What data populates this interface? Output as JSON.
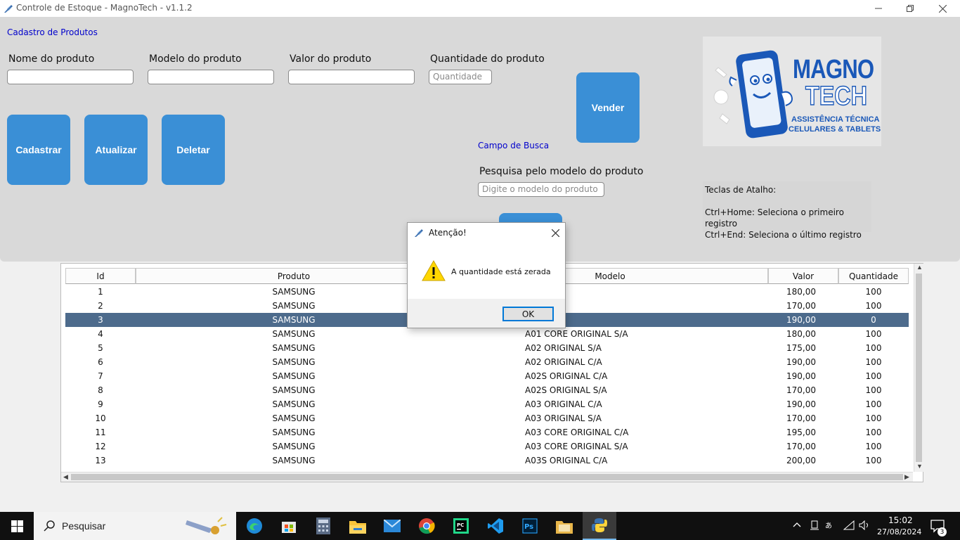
{
  "window": {
    "title": "Controle de Estoque - MagnoTech - v1.1.2",
    "minimize_icon": "minimize-icon",
    "restore_icon": "restore-icon",
    "close_icon": "close-icon"
  },
  "form": {
    "section_label": "Cadastro de Produtos",
    "nome_label": "Nome do produto",
    "nome_value": "",
    "modelo_label": "Modelo do produto",
    "modelo_value": "",
    "valor_label": "Valor do produto",
    "valor_value": "",
    "quantidade_label": "Quantidade do produto",
    "quantidade_placeholder": "Quantidade"
  },
  "buttons": {
    "cadastrar": "Cadastrar",
    "atualizar": "Atualizar",
    "deletar": "Deletar",
    "vender": "Vender",
    "accent_color": "#3a8fd6"
  },
  "search": {
    "section_label": "Campo de Busca",
    "label": "Pesquisa pelo modelo do produto",
    "placeholder": "Digite o modelo do produto"
  },
  "logo": {
    "line1": "MAGNO",
    "line2": "TECH",
    "line3": "ASSISTÊNCIA TÉCNICA",
    "line4": "CELULARES & TABLETS"
  },
  "shortcuts": {
    "title": "Teclas de Atalho:",
    "line1": "Ctrl+Home: Seleciona o primeiro registro",
    "line2": "Ctrl+End: Seleciona o último registro"
  },
  "table": {
    "columns": [
      "Id",
      "Produto",
      "Modelo",
      "Valor",
      "Quantidade"
    ],
    "selected_row": 2,
    "selected_color": "#4d6b8c",
    "rows": [
      [
        "1",
        "SAMSUNG",
        "",
        "180,00",
        "100"
      ],
      [
        "2",
        "SAMSUNG",
        "",
        "170,00",
        "100"
      ],
      [
        "3",
        "SAMSUNG",
        "",
        "190,00",
        "0"
      ],
      [
        "4",
        "SAMSUNG",
        "A01 CORE ORIGINAL S/A",
        "180,00",
        "100"
      ],
      [
        "5",
        "SAMSUNG",
        "A02 ORIGINAL S/A",
        "175,00",
        "100"
      ],
      [
        "6",
        "SAMSUNG",
        "A02 ORIGINAL C/A",
        "190,00",
        "100"
      ],
      [
        "7",
        "SAMSUNG",
        "A02S ORIGINAL C/A",
        "190,00",
        "100"
      ],
      [
        "8",
        "SAMSUNG",
        "A02S ORIGINAL S/A",
        "170,00",
        "100"
      ],
      [
        "9",
        "SAMSUNG",
        "A03 ORIGINAL C/A",
        "190,00",
        "100"
      ],
      [
        "10",
        "SAMSUNG",
        "A03 ORIGINAL S/A",
        "170,00",
        "100"
      ],
      [
        "11",
        "SAMSUNG",
        "A03 CORE ORIGINAL C/A",
        "195,00",
        "100"
      ],
      [
        "12",
        "SAMSUNG",
        "A03 CORE ORIGINAL S/A",
        "170,00",
        "100"
      ],
      [
        "13",
        "SAMSUNG",
        "A03S ORIGINAL C/A",
        "200,00",
        "100"
      ]
    ]
  },
  "dialog": {
    "title": "Atenção!",
    "message": "A quantidade está zerada",
    "ok_label": "OK",
    "icon": "warning-icon"
  },
  "taskbar": {
    "search_placeholder": "Pesquisar",
    "apps": [
      "edge-icon",
      "store-icon",
      "calculator-icon",
      "file-explorer-icon",
      "mail-icon",
      "chrome-icon",
      "pycharm-icon",
      "vscode-icon",
      "photoshop-icon",
      "folder-icon",
      "python-icon"
    ],
    "time": "15:02",
    "date": "27/08/2024",
    "notification_count": "3"
  }
}
